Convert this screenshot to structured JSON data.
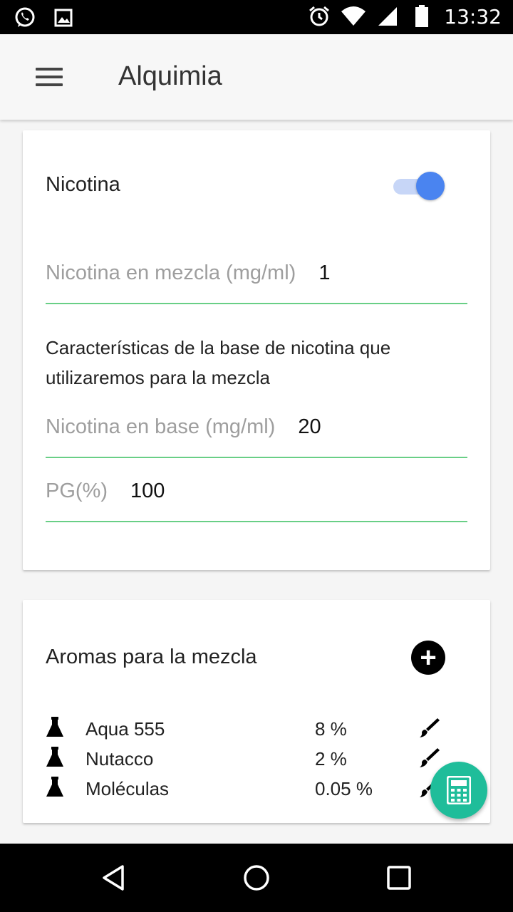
{
  "status_bar": {
    "time": "13:32",
    "left_icons": [
      "whatsapp-icon",
      "image-icon"
    ],
    "right_icons": [
      "alarm-icon",
      "wifi-icon",
      "signal-icon",
      "battery-icon"
    ]
  },
  "app_bar": {
    "title": "Alquimia",
    "menu_icon": "hamburger-menu-icon"
  },
  "nicotine_card": {
    "title": "Nicotina",
    "toggle_on": true,
    "mix_field": {
      "label": "Nicotina en mezcla (mg/ml)",
      "value": "1"
    },
    "description": "Características de la base de nicotina que utilizaremos para la mezcla",
    "base_field": {
      "label": "Nicotina en base (mg/ml)",
      "value": "20"
    },
    "pg_field": {
      "label": "PG(%)",
      "value": "100"
    }
  },
  "aromas_card": {
    "title": "Aromas para la mezcla",
    "add_icon": "add-circle-icon",
    "items": [
      {
        "name": "Aqua 555",
        "percent": "8 %"
      },
      {
        "name": "Nutacco",
        "percent": "2 %"
      },
      {
        "name": "Moléculas",
        "percent": "0.05 %"
      }
    ]
  },
  "fab": {
    "icon": "calculator-icon"
  },
  "colors": {
    "accent": "#4a84f0",
    "field_underline": "#69cf86",
    "fab": "#1fbd9a"
  },
  "nav_bar": {
    "icons": [
      "back-icon",
      "home-icon",
      "recents-icon"
    ]
  }
}
